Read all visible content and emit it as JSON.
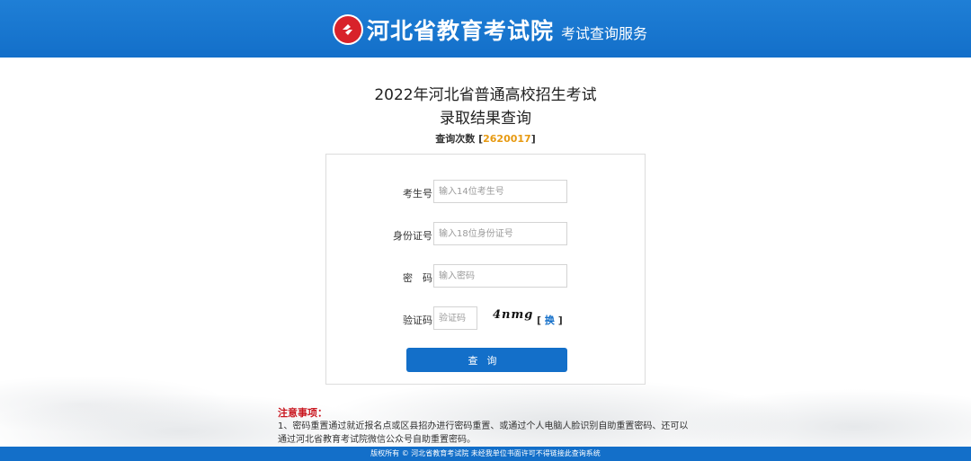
{
  "header": {
    "brand_name": "河北省教育考试院",
    "brand_sub": "考试查询服务",
    "bg_color": "#136fc9",
    "logo_color": "#d8222a",
    "logo_icon": "exam-authority-logo-icon"
  },
  "page": {
    "title_line1": "2022年河北省普通高校招生考试",
    "title_line2": "录取结果查询",
    "count_label": "查询次数",
    "count_open": "[",
    "count_value": "2620017",
    "count_close": "]",
    "count_color": "#e79a12"
  },
  "form": {
    "exam_id": {
      "label": "考生号",
      "placeholder": "输入14位考生号",
      "value": ""
    },
    "id_card": {
      "label": "身份证号",
      "placeholder": "输入18位身份证号",
      "value": ""
    },
    "password": {
      "label": "密　码",
      "placeholder": "输入密码",
      "value": ""
    },
    "captcha": {
      "label": "验证码",
      "placeholder": "验证码",
      "value": "",
      "image_text": "4nmg"
    },
    "refresh_open": "[",
    "refresh_label": "换",
    "refresh_close": "]",
    "submit_label": "查询"
  },
  "notice": {
    "title": "注意事项：",
    "line1": "1、密码重置通过就近报名点或区县招办进行密码重置、或通过个人电脑人脸识别自助重置密码、还可以",
    "line2": "通过河北省教育考试院微信公众号自助重置密码。"
  },
  "footer": {
    "text": "版权所有 © 河北省教育考试院 未经我单位书面许可不得链接此查询系统"
  }
}
